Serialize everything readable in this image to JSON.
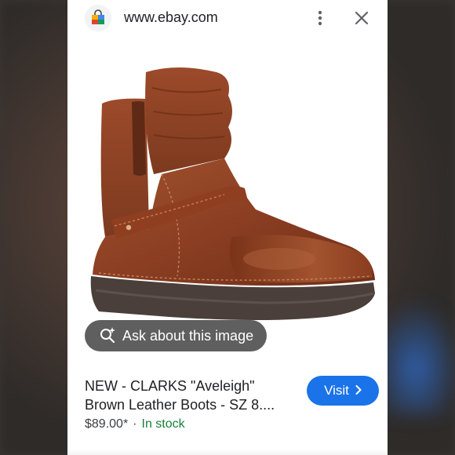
{
  "browser": {
    "url": "www.ebay.com",
    "site_icon": "shopping-bag-icon",
    "more_icon": "more-vert-icon",
    "close_icon": "close-icon"
  },
  "image": {
    "subject": "boot-image",
    "ask_label": "Ask about this image",
    "ask_icon": "lens-sparkle-icon"
  },
  "product": {
    "title_line1": "NEW - CLARKS \"Aveleigh\"",
    "title_line2": "Brown Leather Boots - SZ 8....",
    "price": "$89.00*",
    "separator": "·",
    "stock": "In stock"
  },
  "actions": {
    "visit_label": "Visit",
    "visit_icon": "chevron-right-icon"
  },
  "colors": {
    "accent": "#1a73e8",
    "stock": "#188038"
  }
}
